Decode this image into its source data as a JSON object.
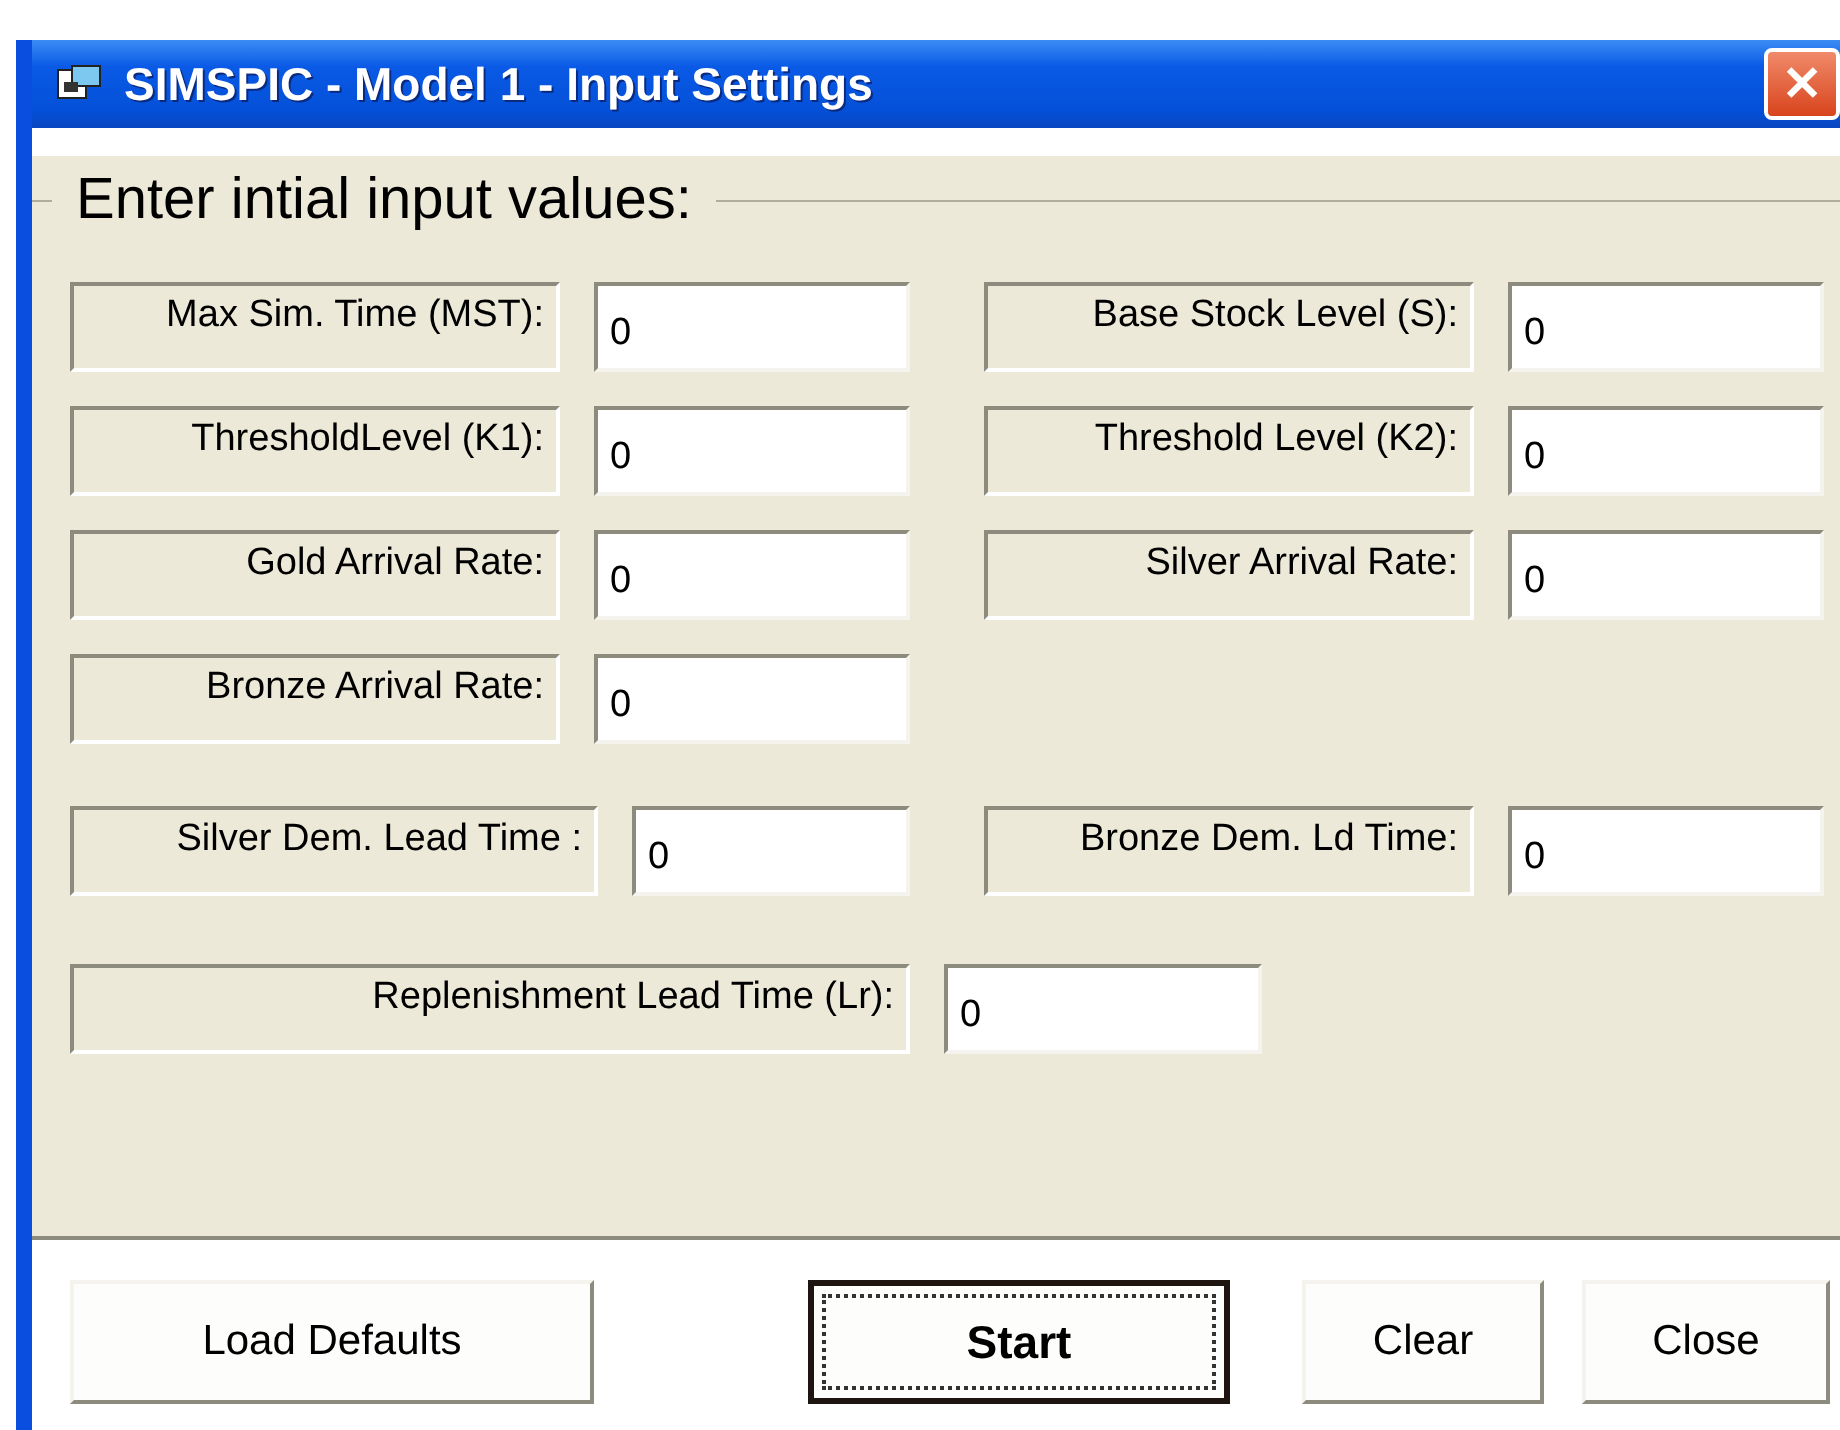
{
  "window": {
    "title": "SIMSPIC - Model 1 - Input Settings",
    "close": "✕"
  },
  "group": {
    "legend": "Enter intial input values:"
  },
  "rows": [
    {
      "fields": [
        {
          "kind": "short",
          "label": "Max Sim. Time (MST):",
          "value": "0"
        },
        {
          "kind": "short",
          "label": "Base Stock Level (S):",
          "value": "0"
        }
      ]
    },
    {
      "fields": [
        {
          "kind": "short",
          "label": "ThresholdLevel (K1):",
          "value": "0"
        },
        {
          "kind": "short",
          "label": "Threshold Level (K2):",
          "value": "0"
        }
      ]
    },
    {
      "fields": [
        {
          "kind": "short",
          "label": "Gold Arrival Rate:",
          "value": "0"
        },
        {
          "kind": "short",
          "label": "Silver Arrival Rate:",
          "value": "0"
        }
      ]
    },
    {
      "fields": [
        {
          "kind": "short",
          "label": "Bronze Arrival Rate:",
          "value": "0"
        }
      ]
    },
    {
      "fields": [
        {
          "kind": "medium",
          "label": "Silver Dem. Lead Time :",
          "value": "0"
        },
        {
          "kind": "short",
          "label": "Bronze Dem. Ld Time:",
          "value": "0"
        }
      ]
    },
    {
      "fields": [
        {
          "kind": "long",
          "label": "Replenishment Lead Time (Lr):",
          "value": "0"
        }
      ]
    }
  ],
  "buttons": [
    {
      "label": "Load Defaults",
      "focused": false
    },
    {
      "label": "Start",
      "focused": true
    },
    {
      "label": "Clear",
      "focused": false
    },
    {
      "label": "Close",
      "focused": false
    }
  ]
}
